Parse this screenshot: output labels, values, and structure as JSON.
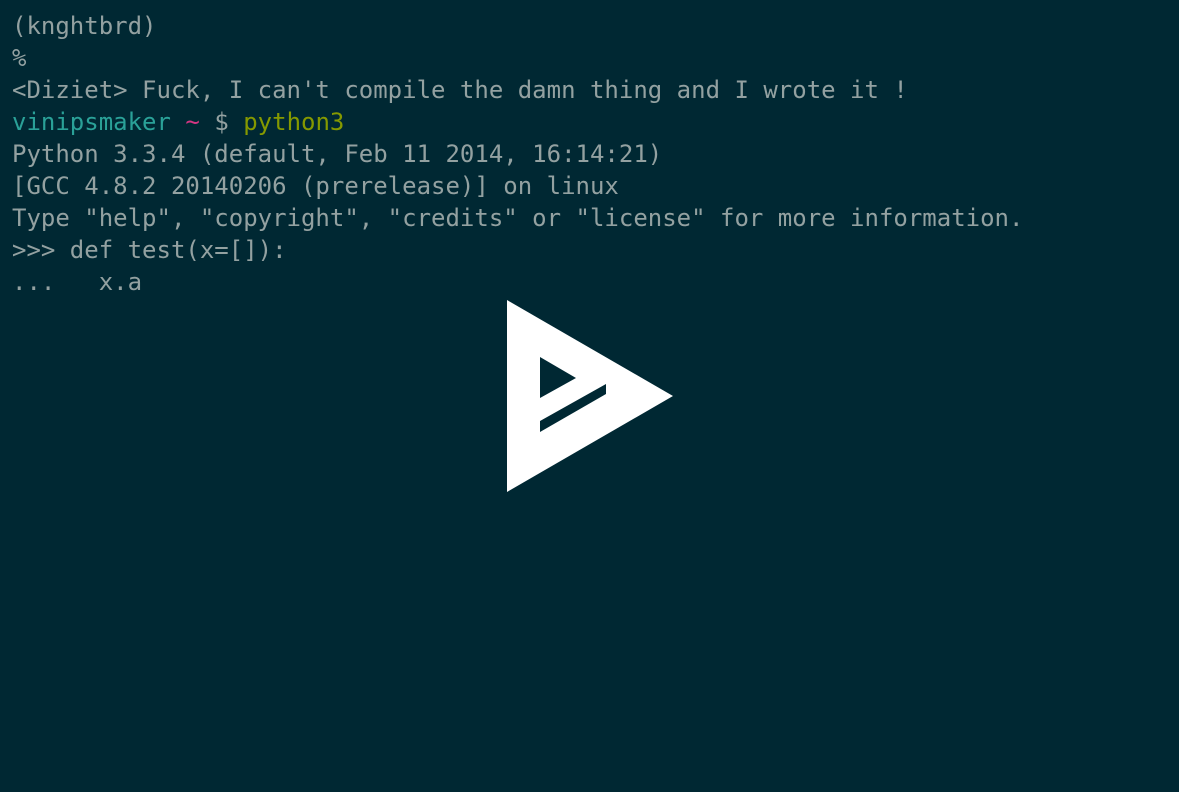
{
  "terminal": {
    "lines": [
      "(knghtbrd)",
      "%",
      "<Diziet> Fuck, I can't compile the damn thing and I wrote it !"
    ],
    "prompt": {
      "user": "vinipsmaker",
      "path": "~",
      "symbol": "$",
      "command": "python3"
    },
    "output": [
      "Python 3.3.4 (default, Feb 11 2014, 16:14:21)",
      "[GCC 4.8.2 20140206 (prerelease)] on linux",
      "Type \"help\", \"copyright\", \"credits\" or \"license\" for more information.",
      ">>> def test(x=[]):",
      "...   x.a"
    ]
  },
  "overlay": {
    "icon": "asciinema-play-icon"
  },
  "colors": {
    "background": "#002833",
    "text": "#93a1a1",
    "user": "#2aa198",
    "path": "#d33682",
    "command": "#859900",
    "icon": "#ffffff"
  }
}
